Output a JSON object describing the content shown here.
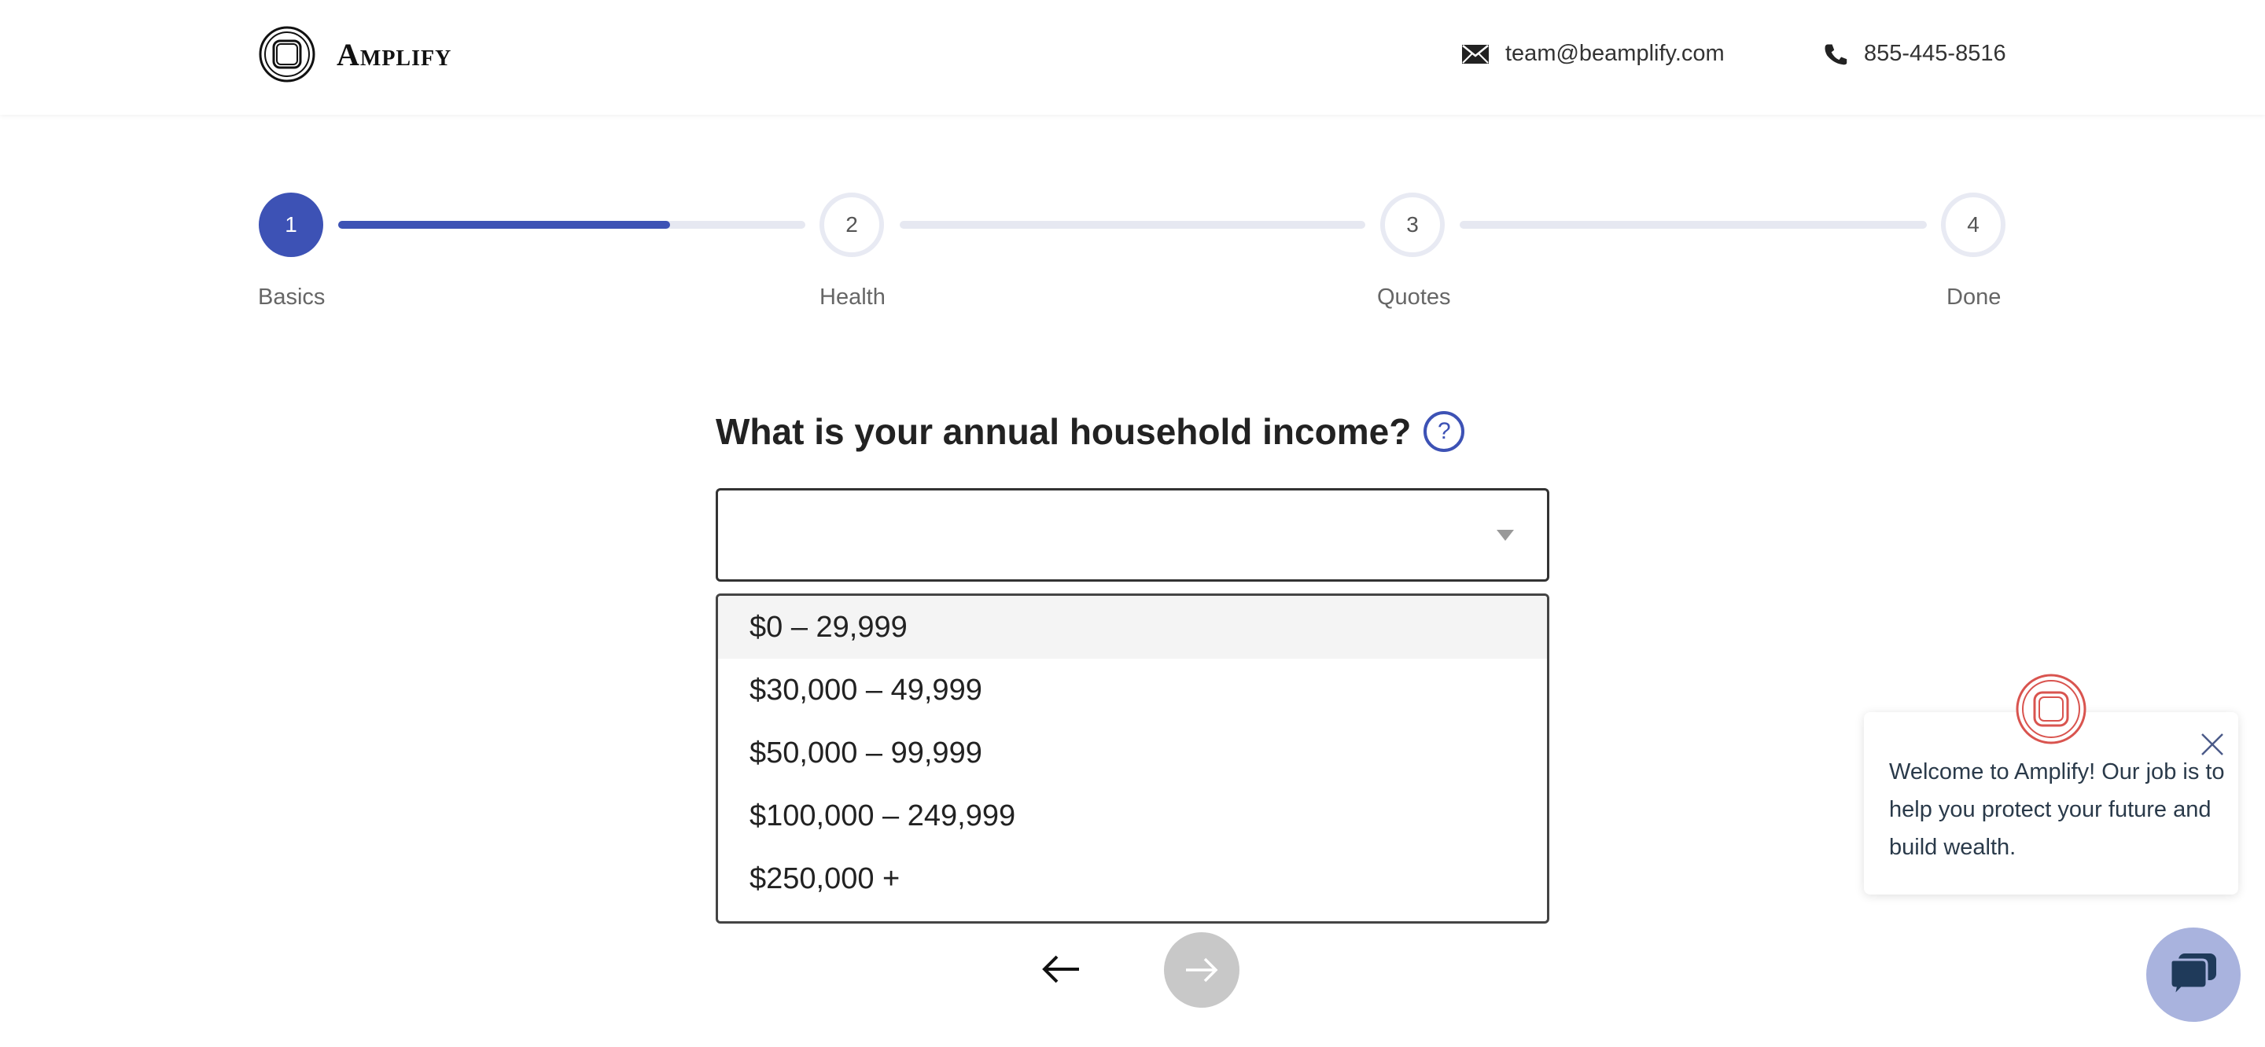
{
  "header": {
    "brand": "Amplify",
    "email": "team@beamplify.com",
    "phone": "855-445-8516"
  },
  "stepper": {
    "steps": [
      {
        "number": "1",
        "label": "Basics",
        "state": "active"
      },
      {
        "number": "2",
        "label": "Health",
        "state": "inactive"
      },
      {
        "number": "3",
        "label": "Quotes",
        "state": "inactive"
      },
      {
        "number": "4",
        "label": "Done",
        "state": "inactive"
      }
    ],
    "progress_first_segment": 0.71,
    "accent_color": "#3d52b5"
  },
  "question": {
    "text": "What is your annual household income?",
    "help_icon": "?"
  },
  "income_select": {
    "value": "",
    "options": [
      "$0 – 29,999",
      "$30,000 – 49,999",
      "$50,000 – 99,999",
      "$100,000 – 249,999",
      "$250,000 +"
    ],
    "highlighted_index": 0
  },
  "navigation": {
    "back_icon": "arrow-left-icon",
    "next_icon": "arrow-right-icon"
  },
  "chat": {
    "message": "Welcome to Amplify! Our job is to help you protect your future and build wealth."
  }
}
